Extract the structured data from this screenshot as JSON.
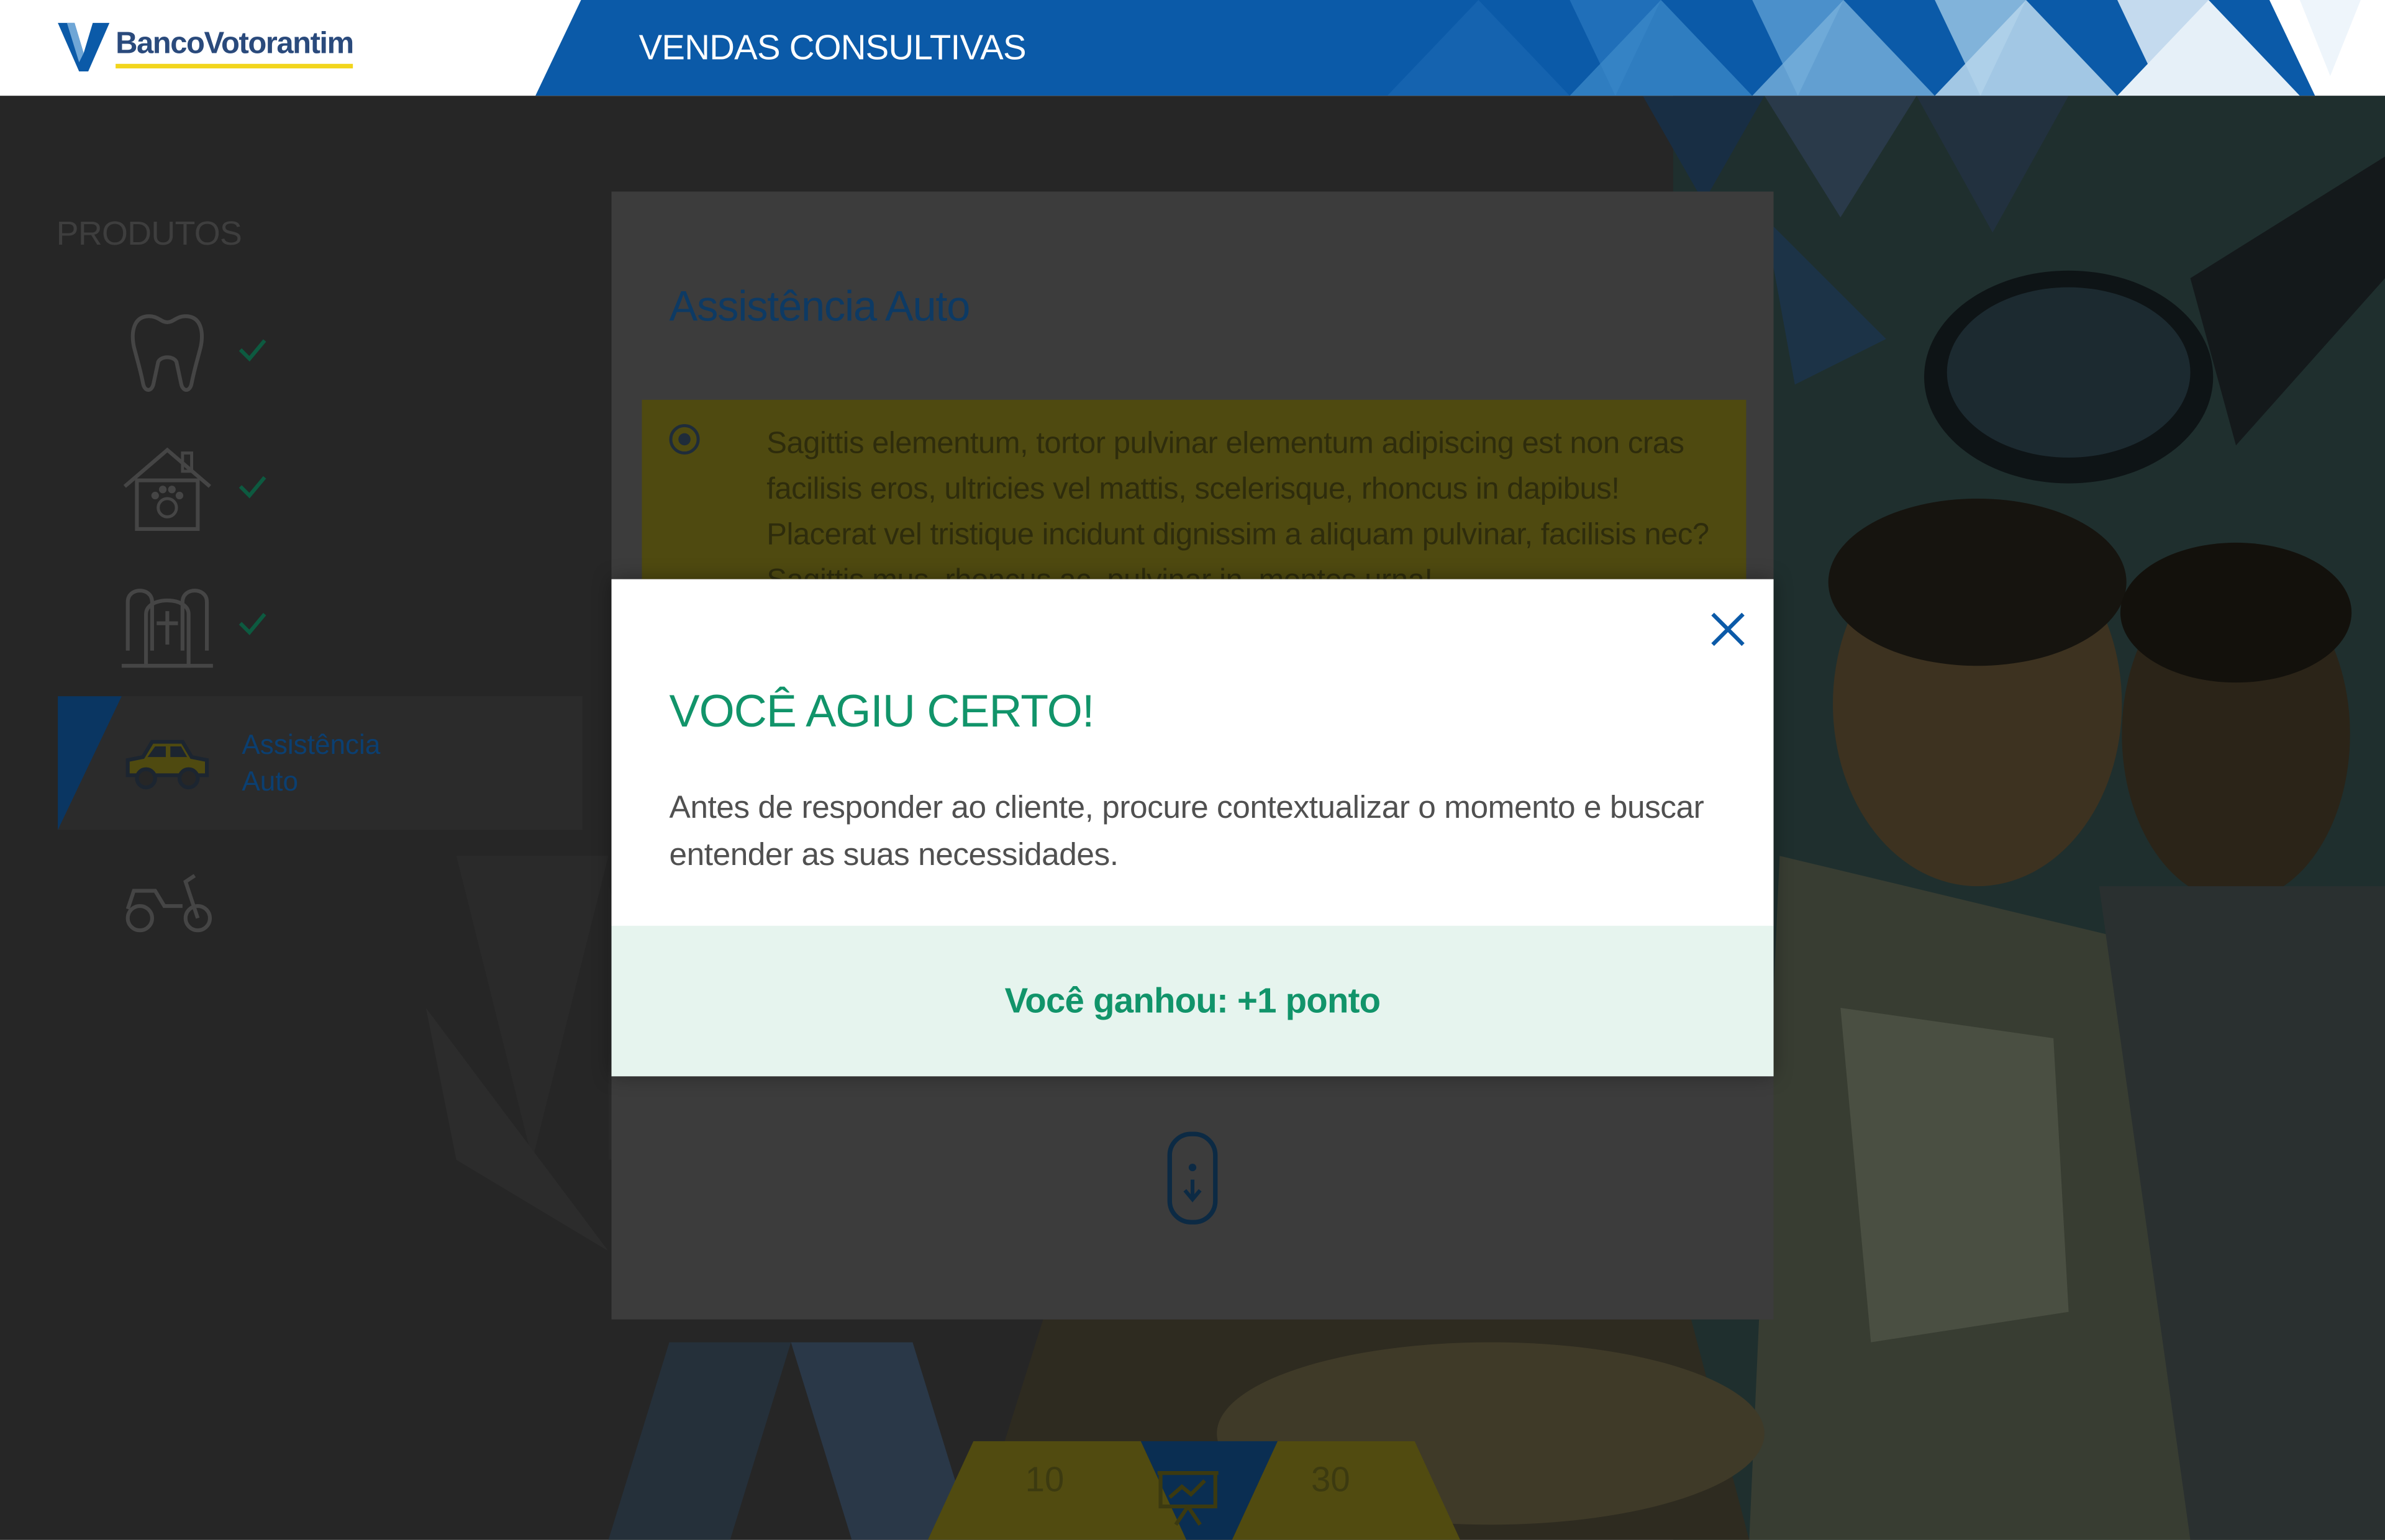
{
  "header": {
    "logo_text": "BancoVotorantim",
    "title": "VENDAS CONSULTIVAS"
  },
  "sidebar": {
    "title": "PRODUTOS",
    "items": [
      {
        "icon": "tooth-icon",
        "completed": true
      },
      {
        "icon": "pet-house-icon",
        "completed": true
      },
      {
        "icon": "tombstones-icon",
        "completed": true
      },
      {
        "icon": "car-icon",
        "label": "Assistência\nAuto",
        "active": true
      },
      {
        "icon": "motorcycle-icon",
        "completed": false
      }
    ]
  },
  "content": {
    "title": "Assistência Auto",
    "option_text": "Sagittis elementum, tortor pulvinar elementum adipiscing est non cras facilisis eros, ultricies vel mattis, scelerisque, rhoncus in dapibus! Placerat vel tristique incidunt dignissim a aliquam pulvinar, facilisis nec? Sagittis mus, rhoncus ac, pulvinar in, montes urna!"
  },
  "footer": {
    "score_left": "10",
    "score_right": "30"
  },
  "modal": {
    "title": "VOCÊ AGIU CERTO!",
    "body": "Antes de responder ao cliente, procure contextualizar o momento e buscar entender as suas necessidades.",
    "points": "Você ganhou: +1 ponto"
  },
  "colors": {
    "brand_blue": "#0b5aa8",
    "accent_green": "#11946a",
    "accent_yellow": "#f2d51c",
    "modal_footer_bg": "#e6f4ee"
  }
}
